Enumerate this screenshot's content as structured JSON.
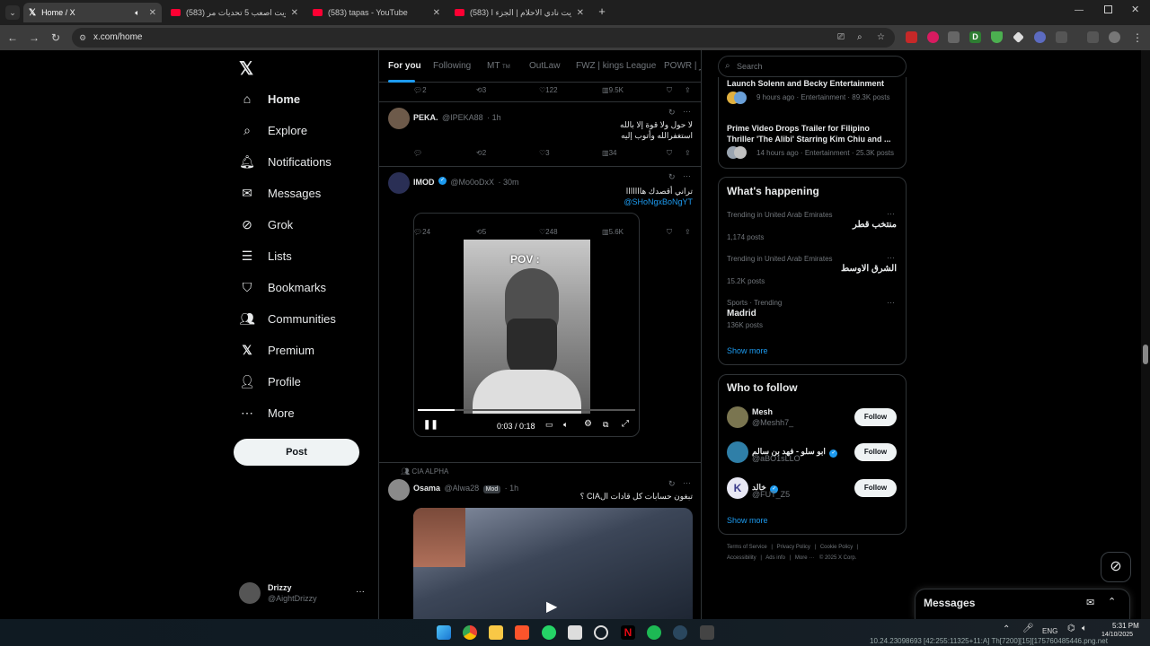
{
  "browser": {
    "tabs": [
      {
        "title": "Home / X",
        "active": true
      },
      {
        "title": "سويت اصعب 5 تحديات مر (583)",
        "active": false
      },
      {
        "title": "(583) tapas - YouTube",
        "active": false
      },
      {
        "title": "سويت نادي الاحلام | الجزء ا (583)",
        "active": false
      }
    ],
    "url": "x.com/home"
  },
  "nav": {
    "items": [
      {
        "label": "Home",
        "icon": "home-icon"
      },
      {
        "label": "Explore",
        "icon": "search-icon"
      },
      {
        "label": "Notifications",
        "icon": "bell-icon"
      },
      {
        "label": "Messages",
        "icon": "mail-icon"
      },
      {
        "label": "Grok",
        "icon": "grok-icon"
      },
      {
        "label": "Lists",
        "icon": "list-icon"
      },
      {
        "label": "Bookmarks",
        "icon": "bookmark-icon"
      },
      {
        "label": "Communities",
        "icon": "people-icon"
      },
      {
        "label": "Premium",
        "icon": "x-logo-icon"
      },
      {
        "label": "Profile",
        "icon": "person-icon"
      },
      {
        "label": "More",
        "icon": "more-circle-icon"
      }
    ],
    "post_label": "Post",
    "account": {
      "name": "Drizzy",
      "handle": "@AightDrizzy"
    }
  },
  "feed": {
    "tabs": [
      "For you",
      "Following",
      "MT",
      "OutLaw",
      "FWZ | kings League",
      "POWR | ور"
    ],
    "mt_badge": "TM",
    "top_actions": {
      "replies": "2",
      "reposts": "3",
      "likes": "122",
      "views": "9.5K"
    },
    "posts": [
      {
        "name": "PEKA.",
        "handle": "@IPEKA88",
        "time": "· 1h",
        "lines": [
          "لا حول ولا قوة إلا بالله",
          "استغفرالله وأتوب إليه"
        ],
        "actions": {
          "replies": "",
          "reposts": "2",
          "likes": "3",
          "views": "34"
        }
      },
      {
        "name": "IMOD",
        "handle": "@Mo0oDxX",
        "time": "· 30m",
        "lines": [
          "تراني أقصدك هااااااا"
        ],
        "link": "@SHoNgxBoNgYT",
        "video": {
          "overlay_text": "POV :",
          "time": "0:03 / 0:18",
          "progress": 0.17
        },
        "actions": {
          "replies": "24",
          "reposts": "5",
          "likes": "248",
          "views": "5.6K"
        }
      },
      {
        "community": "CIA ALPHA",
        "name": "Osama",
        "handle": "@Alwa28",
        "badge": "Mod",
        "time": "· 1h",
        "lines": [
          "تبغون حسابات كل قادات الCIA ؟"
        ]
      }
    ]
  },
  "right": {
    "search_placeholder": "Search",
    "news": [
      {
        "title": "Launch Solenn and Becky Entertainment",
        "meta": "9 hours ago · Entertainment · 89.3K posts"
      },
      {
        "title": "Prime Video Drops Trailer for Filipino Thriller 'The Alibi' Starring Kim Chiu and ...",
        "meta": "14 hours ago · Entertainment · 25.3K posts"
      }
    ],
    "happening": {
      "title": "What's happening",
      "trends": [
        {
          "context": "Trending in United Arab Emirates",
          "title": "منتخب قطر",
          "posts": "1,174 posts"
        },
        {
          "context": "Trending in United Arab Emirates",
          "title": "الشرق الاوسط",
          "posts": "15.2K posts"
        },
        {
          "context": "Sports · Trending",
          "title": "Madrid",
          "posts": "136K posts"
        }
      ],
      "show_more": "Show more"
    },
    "who_to_follow": {
      "title": "Who to follow",
      "users": [
        {
          "name": "Mesh",
          "handle": "@Meshh7_",
          "verified": false
        },
        {
          "name": "ابو سلو - فهد بن سالم",
          "handle": "@aBO1sLLO",
          "verified": true
        },
        {
          "name": "خالد",
          "handle": "@FUT_Z5",
          "verified": true
        }
      ],
      "follow_label": "Follow",
      "show_more": "Show more"
    },
    "footer": {
      "line1": [
        "Terms of Service",
        "|",
        "Privacy Policy",
        "|",
        "Cookie Policy",
        "|"
      ],
      "line2": [
        "Accessibility",
        "|",
        "Ads info",
        "|",
        "More ···",
        "© 2025 X Corp."
      ]
    },
    "messages_label": "Messages"
  },
  "taskbar": {
    "lang": "ENG",
    "time": "5:31 PM",
    "date": "14/10/2025",
    "overlay_text": "10.24.23098693 [42:255:11325+11:A] Th[7200][15][175760485446.png.net"
  },
  "colors": {
    "accent": "#1d9bf0",
    "bg": "#000000",
    "border": "#2f3336",
    "muted": "#71767b"
  }
}
